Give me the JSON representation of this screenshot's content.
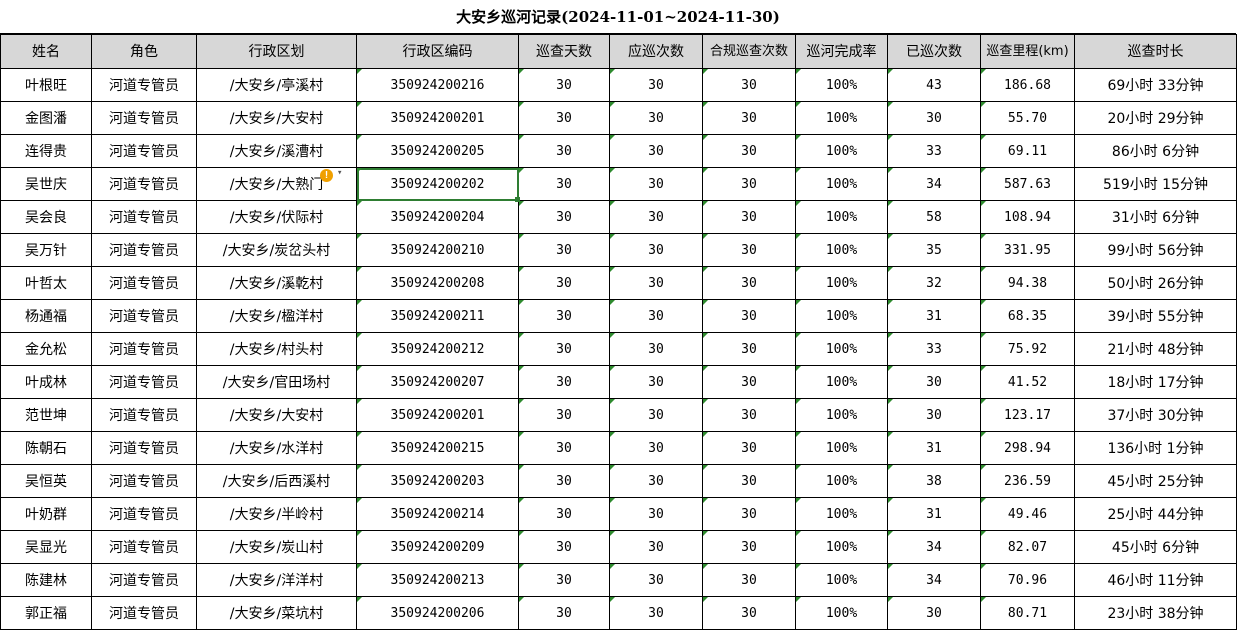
{
  "title": "大安乡巡河记录(2024-11-01~2024-11-30)",
  "headers": [
    "姓名",
    "角色",
    "行政区划",
    "行政区编码",
    "巡查天数",
    "应巡次数",
    "合规巡查次数",
    "巡河完成率",
    "已巡次数",
    "巡查里程(km)",
    "巡查时长"
  ],
  "rows": [
    [
      "叶根旺",
      "河道专管员",
      "/大安乡/亭溪村",
      "350924200216",
      "30",
      "30",
      "30",
      "100%",
      "43",
      "186.68",
      "69小时 33分钟"
    ],
    [
      "金图潘",
      "河道专管员",
      "/大安乡/大安村",
      "350924200201",
      "30",
      "30",
      "30",
      "100%",
      "30",
      "55.70",
      "20小时 29分钟"
    ],
    [
      "连得贵",
      "河道专管员",
      "/大安乡/溪漕村",
      "350924200205",
      "30",
      "30",
      "30",
      "100%",
      "33",
      "69.11",
      "86小时 6分钟"
    ],
    [
      "吴世庆",
      "河道专管员",
      "/大安乡/大熟门",
      "350924200202",
      "30",
      "30",
      "30",
      "100%",
      "34",
      "587.63",
      "519小时 15分钟"
    ],
    [
      "吴会良",
      "河道专管员",
      "/大安乡/伏际村",
      "350924200204",
      "30",
      "30",
      "30",
      "100%",
      "58",
      "108.94",
      "31小时 6分钟"
    ],
    [
      "吴万针",
      "河道专管员",
      "/大安乡/炭岔头村",
      "350924200210",
      "30",
      "30",
      "30",
      "100%",
      "35",
      "331.95",
      "99小时 56分钟"
    ],
    [
      "叶哲太",
      "河道专管员",
      "/大安乡/溪乾村",
      "350924200208",
      "30",
      "30",
      "30",
      "100%",
      "32",
      "94.38",
      "50小时 26分钟"
    ],
    [
      "杨通福",
      "河道专管员",
      "/大安乡/楹洋村",
      "350924200211",
      "30",
      "30",
      "30",
      "100%",
      "31",
      "68.35",
      "39小时 55分钟"
    ],
    [
      "金允松",
      "河道专管员",
      "/大安乡/村头村",
      "350924200212",
      "30",
      "30",
      "30",
      "100%",
      "33",
      "75.92",
      "21小时 48分钟"
    ],
    [
      "叶成林",
      "河道专管员",
      "/大安乡/官田场村",
      "350924200207",
      "30",
      "30",
      "30",
      "100%",
      "30",
      "41.52",
      "18小时 17分钟"
    ],
    [
      "范世坤",
      "河道专管员",
      "/大安乡/大安村",
      "350924200201",
      "30",
      "30",
      "30",
      "100%",
      "30",
      "123.17",
      "37小时 30分钟"
    ],
    [
      "陈朝石",
      "河道专管员",
      "/大安乡/水洋村",
      "350924200215",
      "30",
      "30",
      "30",
      "100%",
      "31",
      "298.94",
      "136小时 1分钟"
    ],
    [
      "吴恒英",
      "河道专管员",
      "/大安乡/后西溪村",
      "350924200203",
      "30",
      "30",
      "30",
      "100%",
      "38",
      "236.59",
      "45小时 25分钟"
    ],
    [
      "叶奶群",
      "河道专管员",
      "/大安乡/半岭村",
      "350924200214",
      "30",
      "30",
      "30",
      "100%",
      "31",
      "49.46",
      "25小时 44分钟"
    ],
    [
      "吴显光",
      "河道专管员",
      "/大安乡/炭山村",
      "350924200209",
      "30",
      "30",
      "30",
      "100%",
      "34",
      "82.07",
      "45小时 6分钟"
    ],
    [
      "陈建林",
      "河道专管员",
      "/大安乡/洋洋村",
      "350924200213",
      "30",
      "30",
      "30",
      "100%",
      "34",
      "70.96",
      "46小时 11分钟"
    ],
    [
      "郭正福",
      "河道专管员",
      "/大安乡/菜坑村",
      "350924200206",
      "30",
      "30",
      "30",
      "100%",
      "30",
      "80.71",
      "23小时 38分钟"
    ]
  ],
  "selected_cell": {
    "row": 3,
    "col": 3
  },
  "warning_icon": "exclamation-circle-icon",
  "colors": {
    "header_bg": "#d7d7d7",
    "selection": "#2e7d32",
    "warning": "#f0a000",
    "grid": "#000000"
  }
}
